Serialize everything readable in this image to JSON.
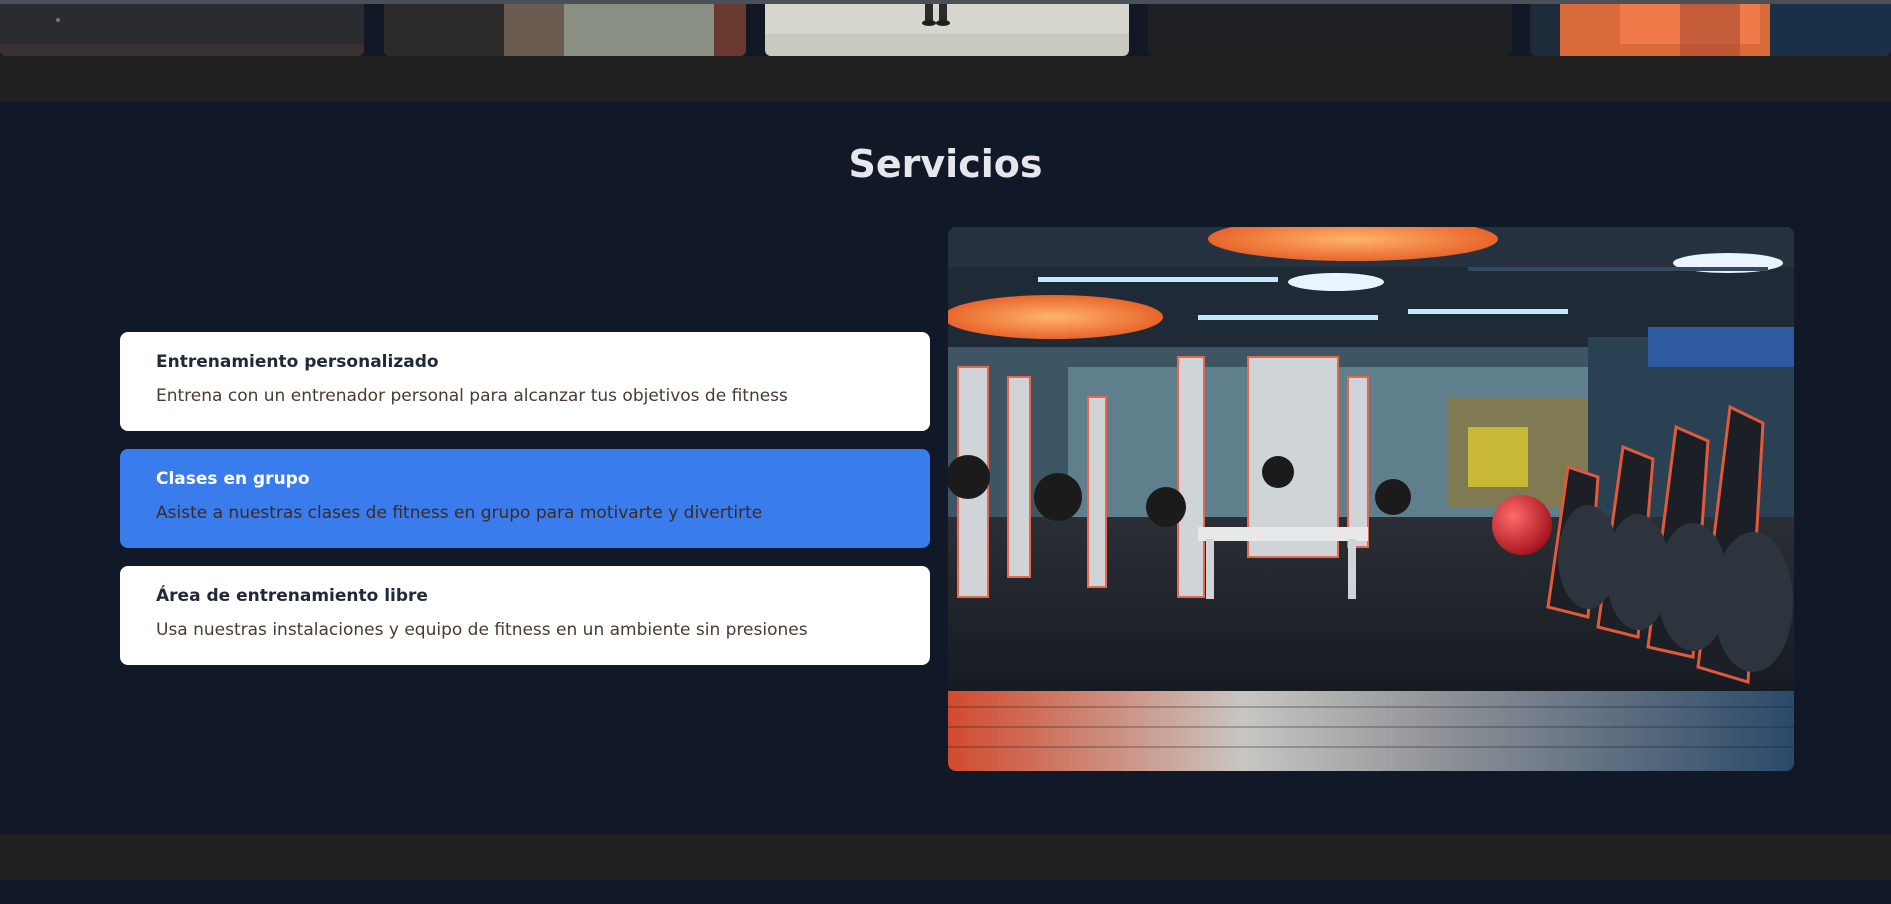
{
  "services": {
    "title": "Servicios",
    "items": [
      {
        "title": "Entrenamiento personalizado",
        "description": "Entrena con un entrenador personal para alcanzar tus objetivos de fitness",
        "active": false
      },
      {
        "title": "Clases en grupo",
        "description": "Asiste a nuestras clases de fitness en grupo para motivarte y divertirte",
        "active": true
      },
      {
        "title": "Área de entrenamiento libre",
        "description": "Usa nuestras instalaciones y equipo de fitness en un ambiente sin presiones",
        "active": false
      }
    ],
    "image_alt": "gym interior"
  },
  "colors": {
    "page_background": "#111827",
    "band_background": "#202020",
    "active_card": "#3b7ced",
    "card_background": "#ffffff"
  }
}
